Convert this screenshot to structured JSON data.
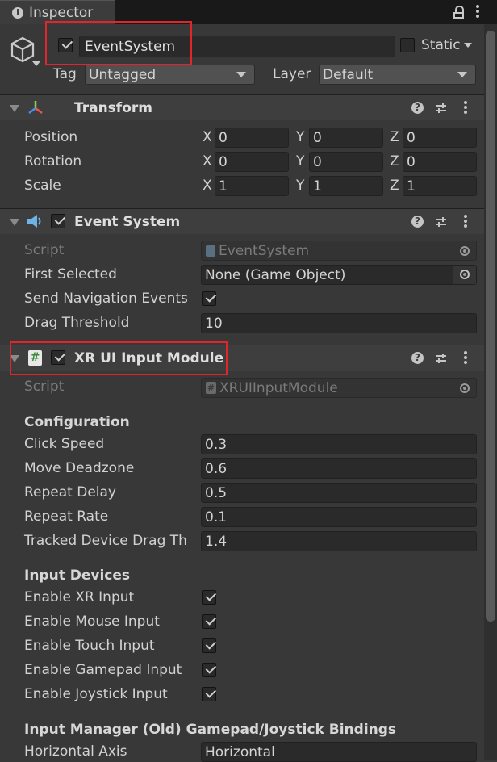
{
  "tab": {
    "icon": "info-icon",
    "title": "Inspector"
  },
  "tab_icons": [
    "lock-icon",
    "more-options-icon"
  ],
  "header": {
    "object_name": "EventSystem",
    "static_label": "Static",
    "tag_label": "Tag",
    "tag_value": "Untagged",
    "layer_label": "Layer",
    "layer_value": "Default"
  },
  "transform": {
    "title": "Transform",
    "rows": [
      {
        "label": "Position",
        "x": "0",
        "y": "0",
        "z": "0"
      },
      {
        "label": "Rotation",
        "x": "0",
        "y": "0",
        "z": "0"
      },
      {
        "label": "Scale",
        "x": "1",
        "y": "1",
        "z": "1"
      }
    ],
    "axes": [
      "X",
      "Y",
      "Z"
    ]
  },
  "event_system": {
    "title": "Event System",
    "script_label": "Script",
    "script_value": "EventSystem",
    "first_selected_label": "First Selected",
    "first_selected_value": "None (Game Object)",
    "send_nav_label": "Send Navigation Events",
    "send_nav_checked": true,
    "drag_threshold_label": "Drag Threshold",
    "drag_threshold_value": "10"
  },
  "xr_module": {
    "title": "XR UI Input Module",
    "script_label": "Script",
    "script_value": "XRUIInputModule",
    "configuration_heading": "Configuration",
    "config": [
      {
        "label": "Click Speed",
        "value": "0.3"
      },
      {
        "label": "Move Deadzone",
        "value": "0.6"
      },
      {
        "label": "Repeat Delay",
        "value": "0.5"
      },
      {
        "label": "Repeat Rate",
        "value": "0.1"
      },
      {
        "label": "Tracked Device Drag Th",
        "value": "1.4"
      }
    ],
    "input_devices_heading": "Input Devices",
    "devices": [
      {
        "label": "Enable XR Input",
        "checked": true
      },
      {
        "label": "Enable Mouse Input",
        "checked": true
      },
      {
        "label": "Enable Touch Input",
        "checked": true
      },
      {
        "label": "Enable Gamepad Input",
        "checked": true
      },
      {
        "label": "Enable Joystick Input",
        "checked": true
      }
    ],
    "bindings_heading": "Input Manager (Old) Gamepad/Joystick Bindings",
    "horizontal_axis_label": "Horizontal Axis",
    "horizontal_axis_value": "Horizontal"
  },
  "colors": {
    "highlight": "#e0262b",
    "background": "#383838",
    "header": "#3e3e3e"
  }
}
